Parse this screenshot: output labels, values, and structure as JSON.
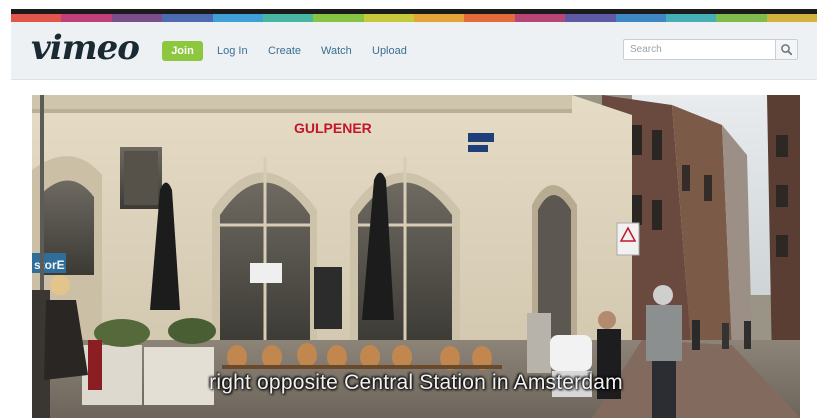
{
  "brand": {
    "logo_text": "vimeo",
    "stripe_colors": [
      "#e2554a",
      "#c1407a",
      "#7a4e8c",
      "#4c6bb0",
      "#3f9fd6",
      "#49b5a2",
      "#88c443",
      "#c8c83c",
      "#e5a33a",
      "#e36b3a",
      "#b74576",
      "#5f5aa5",
      "#3e86c4",
      "#46aeb6",
      "#7fbc4c",
      "#d3b13d"
    ]
  },
  "header": {
    "join_label": "Join",
    "nav": {
      "login": "Log In",
      "create": "Create",
      "watch": "Watch",
      "upload": "Upload"
    },
    "search": {
      "placeholder": "Search",
      "icon": "magnifier-icon"
    }
  },
  "video": {
    "subtitle": "right opposite Central Station in Amsterdam",
    "signs": {
      "cafe": "GULPENER",
      "corner": "storE"
    }
  }
}
